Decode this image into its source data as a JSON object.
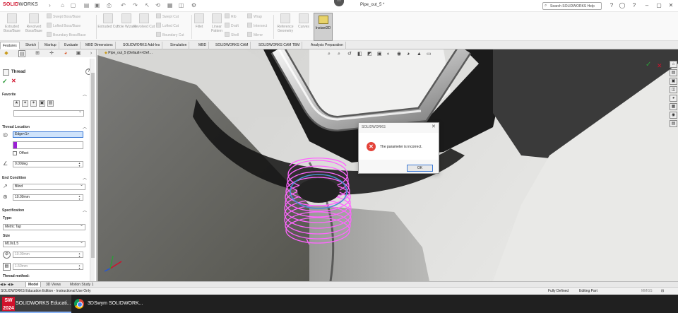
{
  "titlebar": {
    "logo_brand": "SOLID",
    "logo_suffix": "WORKS",
    "doc_title": "Pipe_out_5 *",
    "search_placeholder": "Search SOLIDWORKS Help",
    "collapse_glyph": "⋯",
    "qa_icons": [
      "home-icon",
      "new-document-icon",
      "open-icon",
      "save-icon",
      "print-icon",
      "undo-icon",
      "redo-icon",
      "select-icon",
      "rebuild-icon",
      "options-icon"
    ]
  },
  "ribbon": {
    "extruded_boss": "Extruded Boss/Base",
    "revolved_boss": "Revolved Boss/Base",
    "swept_boss": "Swept Boss/Base",
    "lofted_boss": "Lofted Boss/Base",
    "boundary_boss": "Boundary Boss/Base",
    "extruded_cut": "Extruded Cut",
    "hole_wizard": "Hole Wizard",
    "revolved_cut": "Revolved Cut",
    "swept_cut": "Swept Cut",
    "lofted_cut": "Lofted Cut",
    "boundary_cut": "Boundary Cut",
    "fillet": "Fillet",
    "linear_pattern": "Linear Pattern",
    "rib": "Rib",
    "draft": "Draft",
    "shell": "Shell",
    "wrap": "Wrap",
    "intersect": "Intersect",
    "mirror": "Mirror",
    "reference_geometry": "Reference Geometry",
    "curves": "Curves",
    "instant3d": "Instant3D"
  },
  "tabs": [
    "Features",
    "Sketch",
    "Markup",
    "Evaluate",
    "MBD Dimensions",
    "SOLIDWORKS Add-Ins",
    "Simulation",
    "MBD",
    "SOLIDWORKS CAM",
    "SOLIDWORKS CAM TBM",
    "Analysis Preparation"
  ],
  "viewport": {
    "breadcrumb": "Pipe_out_5 (Default<<Def…"
  },
  "panel": {
    "title": "Thread",
    "help": "?",
    "ok": "✓",
    "cancel": "✕",
    "favorite": "Favorite",
    "thread_location": "Thread Location",
    "edge_value": "Edge<1>",
    "offset": "Offset",
    "angle_value": "0.00deg",
    "end_condition": "End Condition",
    "end_type": "Blind",
    "depth": "10.00mm",
    "specification": "Specification",
    "type_label": "Type:",
    "type_value": "Metric Tap",
    "size_label": "Size",
    "size_value": "M10x1.5",
    "diameter": "10.00mm",
    "pitch": "1.50mm",
    "thread_method": "Thread method:"
  },
  "dialog": {
    "title": "SOLIDWORKS",
    "close": "✕",
    "message": "The parameter is incorrect.",
    "ok": "OK"
  },
  "bottom_tabs": [
    "Model",
    "3D Views",
    "Motion Study 1"
  ],
  "status": {
    "edition": "SOLIDWORKS Education Edition - Instructional Use Only",
    "defined": "Fully Defined",
    "editing": "Editing Part",
    "units": "MMGS"
  },
  "taskbar": {
    "app1": "SOLIDWORKS Educati...",
    "app2": "3DSwym SOLIDWORK...",
    "sw_badge": "SW\n2024"
  },
  "colors": {
    "brand": "#d0112b",
    "selection": "#cfe3fb",
    "thread_preview": "#ff66ff",
    "error": "#e4433a"
  }
}
